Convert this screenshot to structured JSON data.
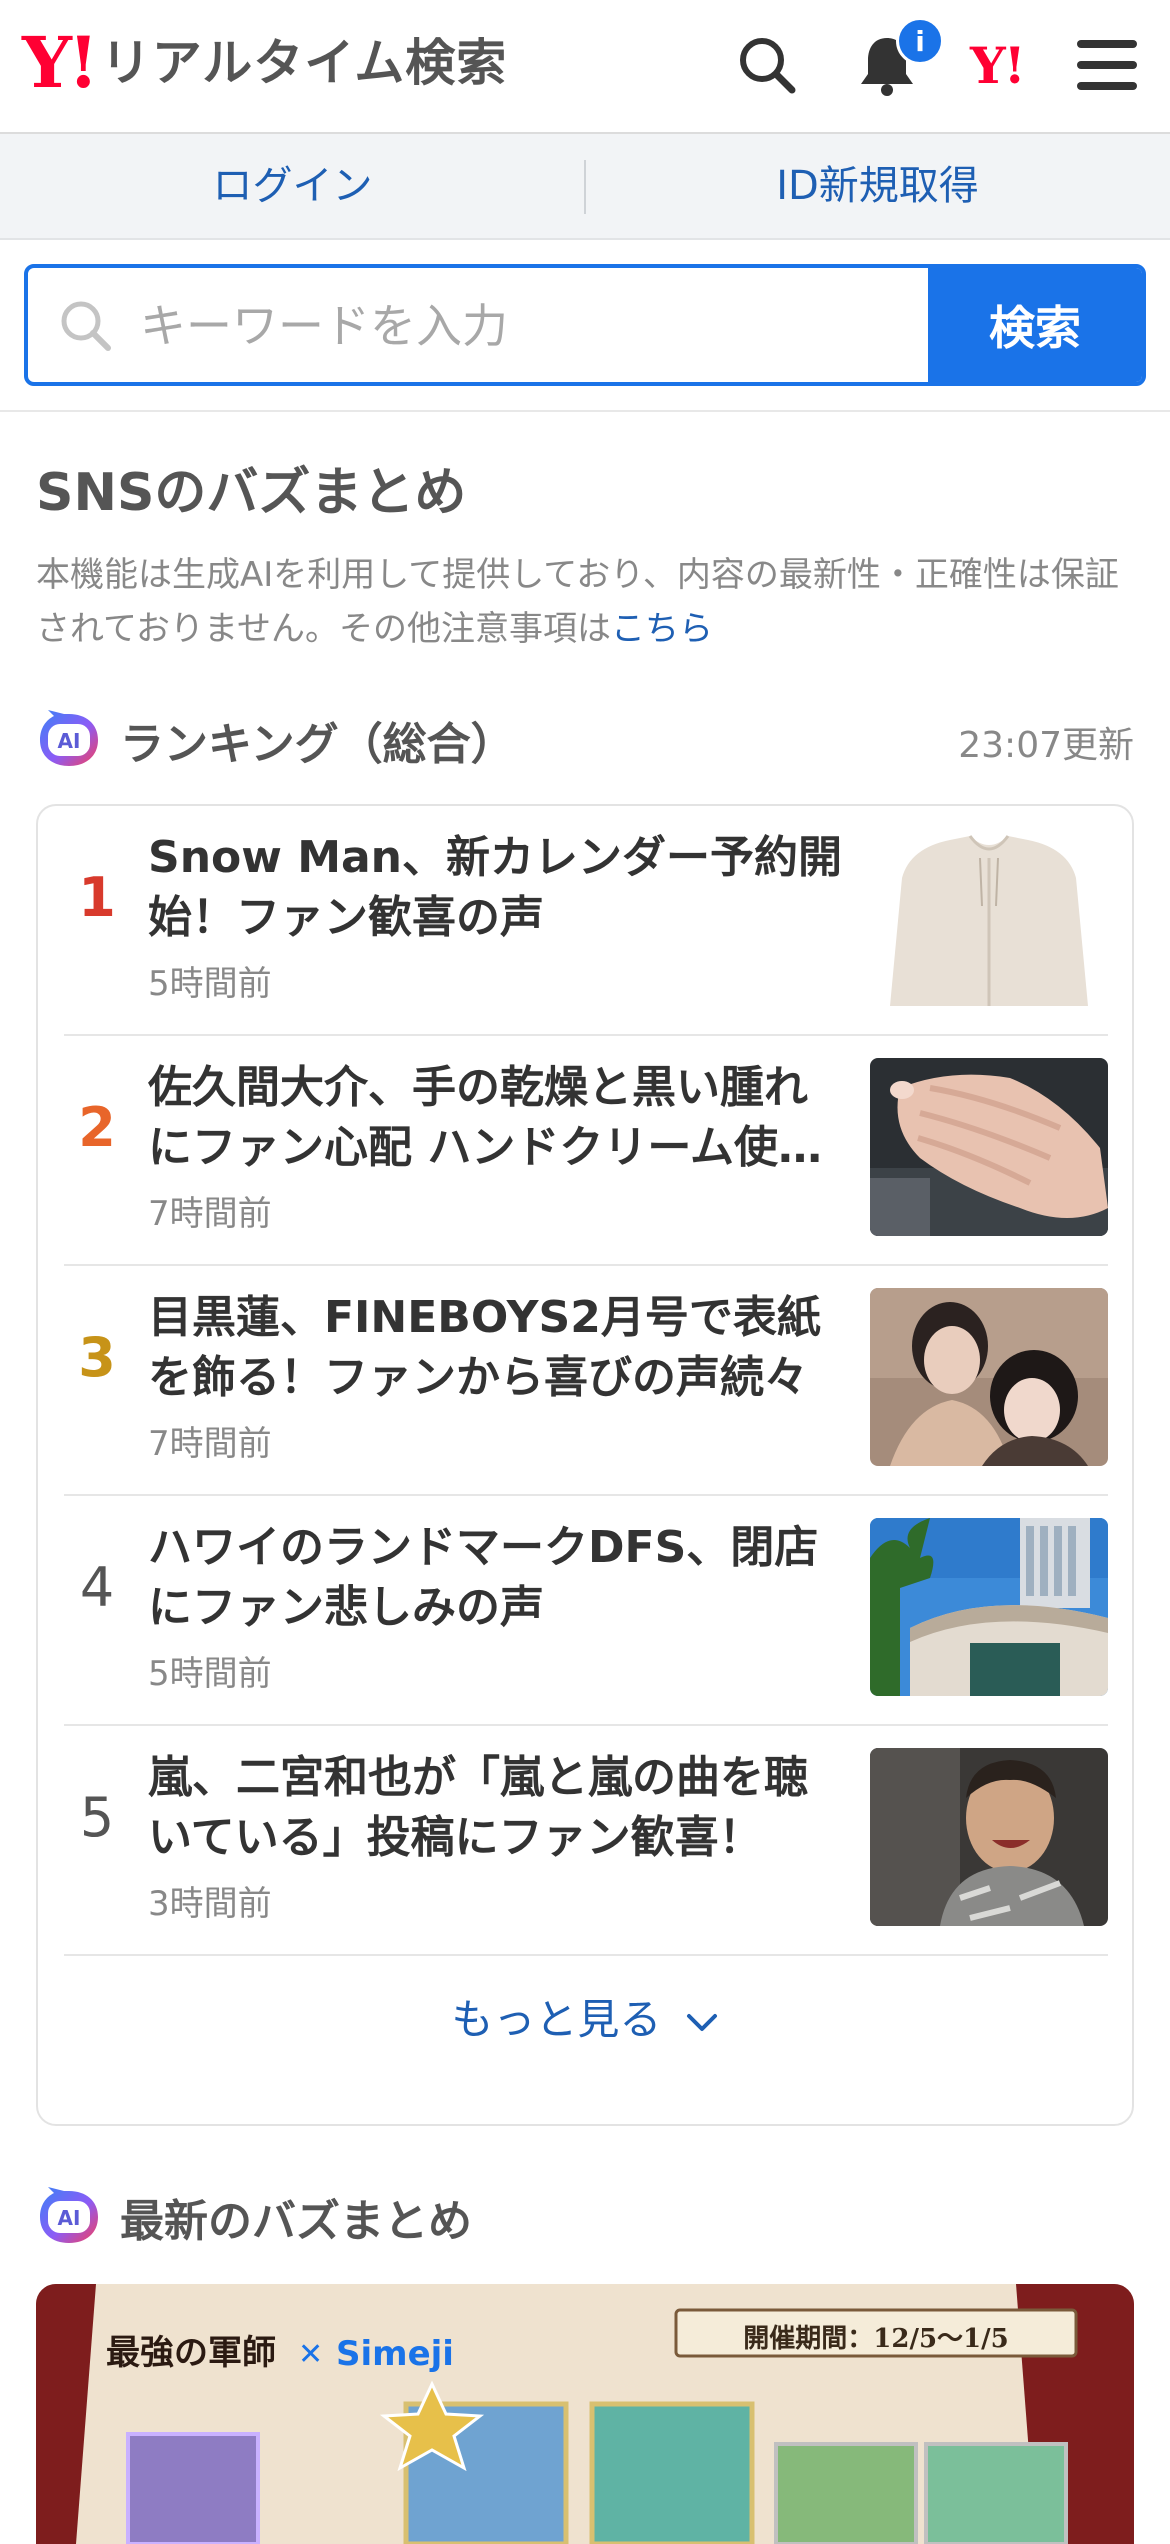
{
  "header": {
    "logo_y": "Y!",
    "logo_text": "リアルタイム検索",
    "notification_badge": "i",
    "y_mark": "Y!"
  },
  "login_bar": {
    "login": "ログイン",
    "register": "ID新規取得"
  },
  "search": {
    "placeholder": "キーワードを入力",
    "button": "検索"
  },
  "sns": {
    "title": "SNSのバズまとめ",
    "notice": "本機能は生成AIを利用して提供しており、内容の最新性・正確性は保証されておりません。その他注意事項は",
    "notice_link": "こちら"
  },
  "ranking": {
    "title": "ランキング（総合）",
    "updated": "23:07更新",
    "items": [
      {
        "rank": "1",
        "title": "Snow Man、新カレンダー予約開始！ファン歓喜の声",
        "time": "5時間前",
        "color": "#d83a2c",
        "thumb": "beige-hoodie"
      },
      {
        "rank": "2",
        "title": "佐久間大介、手の乾燥と黒い腫れにファン心配 ハンドクリーム使…",
        "time": "7時間前",
        "color": "#e8652a",
        "thumb": "hand-photo"
      },
      {
        "rank": "3",
        "title": "目黒蓮、FINEBOYS2月号で表紙を飾る！ファンから喜びの声続々",
        "time": "7時間前",
        "color": "#c79318",
        "thumb": "portrait-photo"
      },
      {
        "rank": "4",
        "title": "ハワイのランドマークDFS、閉店にファン悲しみの声",
        "time": "5時間前",
        "color": "#555555",
        "thumb": "building-photo"
      },
      {
        "rank": "5",
        "title": "嵐、二宮和也が「嵐と嵐の曲を聴いている」投稿にファン歓喜！",
        "time": "3時間前",
        "color": "#555555",
        "thumb": "car-selfie"
      }
    ],
    "more": "もっと見る"
  },
  "latest": {
    "title": "最新のバズまとめ",
    "banner_period": "開催期間：12/5〜1/5",
    "banner_brand": "Simeji"
  },
  "colors": {
    "accent": "#1a73e8",
    "brand_red": "#ff0033",
    "link": "#1e5fb3"
  }
}
